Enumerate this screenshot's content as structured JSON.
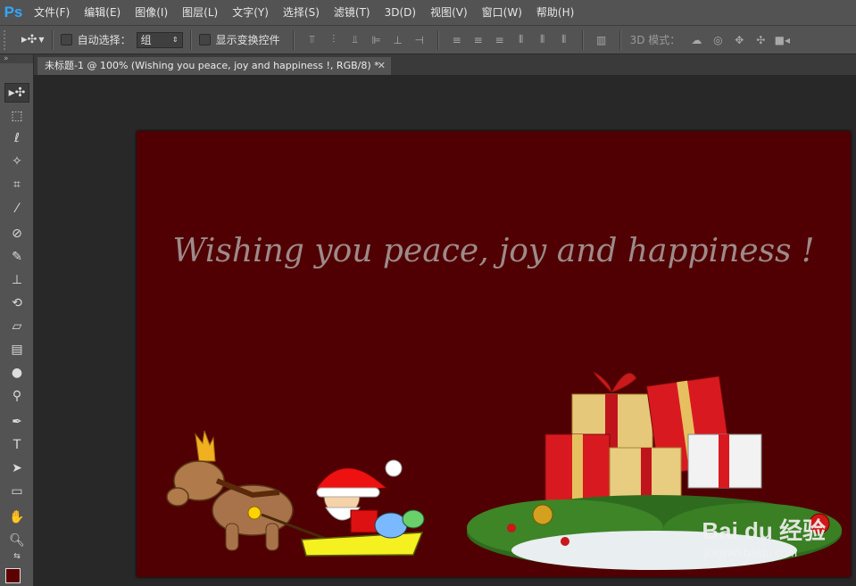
{
  "app": {
    "logo": "Ps"
  },
  "menu": [
    "文件(F)",
    "编辑(E)",
    "图像(I)",
    "图层(L)",
    "文字(Y)",
    "选择(S)",
    "滤镜(T)",
    "3D(D)",
    "视图(V)",
    "窗口(W)",
    "帮助(H)"
  ],
  "options": {
    "auto_select_label": "自动选择：",
    "auto_select_value": "组",
    "show_transform_label": "显示变换控件",
    "mode_3d_label": "3D 模式："
  },
  "document": {
    "tab_title": "未标题-1 @ 100% (Wishing you peace, joy and happiness !, RGB/8) *",
    "greeting": "Wishing you peace, joy and happiness !"
  },
  "watermark": {
    "logo": "Bai du 经验",
    "url": "jingyan.baidu.com"
  },
  "colors": {
    "canvas_bg": "#500002",
    "foreground": "#5c0000",
    "ui_bg": "#535353",
    "workspace": "#282828"
  }
}
